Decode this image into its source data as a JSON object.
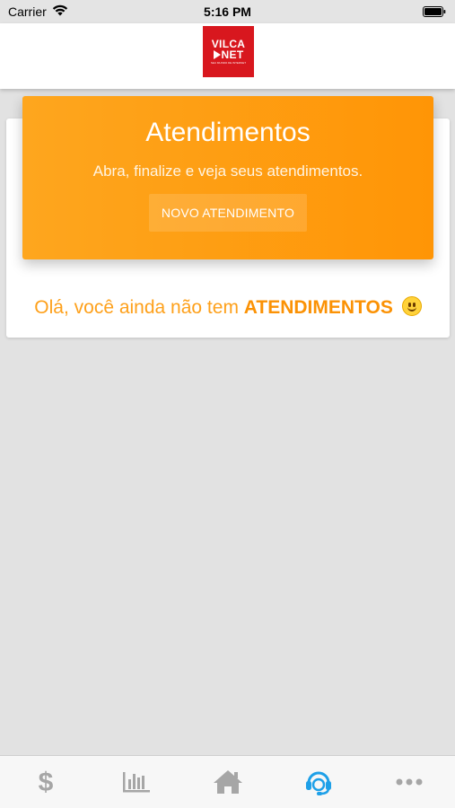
{
  "status_bar": {
    "carrier": "Carrier",
    "time": "5:16 PM"
  },
  "header": {
    "logo": {
      "line1": "VILCA",
      "line2": "NET",
      "tagline": "SEU MUNDO DE INTERNET"
    }
  },
  "banner": {
    "title": "Atendimentos",
    "subtitle": "Abra, finalize e veja seus atendimentos.",
    "button_label": "NOVO ATENDIMENTO"
  },
  "empty_state": {
    "text": "Olá, você ainda não tem ",
    "highlight": "ATENDIMENTOS"
  },
  "tab_bar": {
    "items": [
      {
        "icon": "dollar-icon",
        "active": false
      },
      {
        "icon": "chart-icon",
        "active": false
      },
      {
        "icon": "home-icon",
        "active": false
      },
      {
        "icon": "headset-icon",
        "active": true
      },
      {
        "icon": "more-icon",
        "active": false
      }
    ],
    "active_color": "#1ea0e8",
    "inactive_color": "#a6a6a6"
  },
  "colors": {
    "accent": "#ff9a0d",
    "logo_red": "#d8171e"
  }
}
